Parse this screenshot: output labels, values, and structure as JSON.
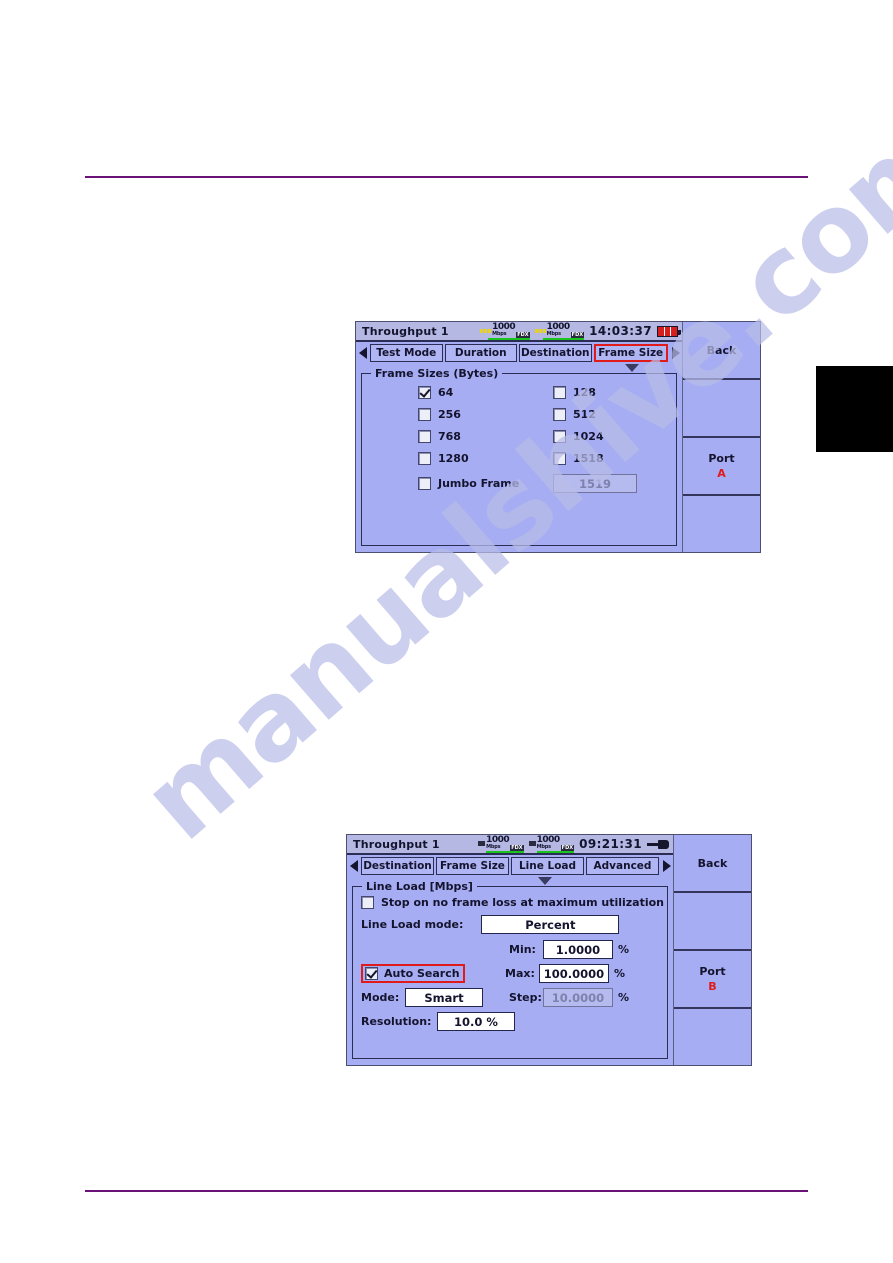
{
  "page": {
    "watermark_text": "manualshive.com",
    "rule_color": "#6b1278",
    "chapter_tab_color": "#000000"
  },
  "screenshot_frame_size": {
    "titlebar": {
      "title": "Throughput 1",
      "clock": "14:03:37",
      "port_indicators": [
        {
          "speed": "1000",
          "unit": "Mbps",
          "duplex": "FDX",
          "link": "up"
        },
        {
          "speed": "1000",
          "unit": "Mbps",
          "duplex": "FDX",
          "link": "up"
        }
      ],
      "power_icon": "battery-icon"
    },
    "tabs": {
      "prev_icon": "chevron-left-icon",
      "next_icon": "chevron-right-icon",
      "items": [
        {
          "label": "Test Mode",
          "selected": false
        },
        {
          "label": "Duration",
          "selected": false
        },
        {
          "label": "Destination",
          "selected": false
        },
        {
          "label": "Frame Size",
          "selected": true
        }
      ]
    },
    "group": {
      "title": "Frame Sizes (Bytes)",
      "checkboxes": [
        {
          "label": "64",
          "checked": true
        },
        {
          "label": "128",
          "checked": false
        },
        {
          "label": "256",
          "checked": false
        },
        {
          "label": "512",
          "checked": false
        },
        {
          "label": "768",
          "checked": false
        },
        {
          "label": "1024",
          "checked": false
        },
        {
          "label": "1280",
          "checked": false
        },
        {
          "label": "1518",
          "checked": false
        }
      ],
      "jumbo": {
        "label": "Jumbo Frame",
        "checked": false,
        "value": "1519",
        "disabled": true
      }
    },
    "side_buttons": [
      {
        "label": "Back",
        "sub": ""
      },
      {
        "label": "",
        "sub": ""
      },
      {
        "label": "Port",
        "sub": "A"
      },
      {
        "label": "",
        "sub": ""
      }
    ]
  },
  "screenshot_line_load": {
    "titlebar": {
      "title": "Throughput 1",
      "clock": "09:21:31",
      "port_indicators": [
        {
          "speed": "1000",
          "unit": "Mbps",
          "duplex": "FDX",
          "link": "up"
        },
        {
          "speed": "1000",
          "unit": "Mbps",
          "duplex": "FDX",
          "link": "up"
        }
      ],
      "power_icon": "power-plug-icon"
    },
    "tabs": {
      "prev_icon": "chevron-left-icon",
      "next_icon": "chevron-right-icon",
      "items": [
        {
          "label": "Destination",
          "selected": false
        },
        {
          "label": "Frame Size",
          "selected": false
        },
        {
          "label": "Line Load",
          "selected": true
        },
        {
          "label": "Advanced",
          "selected": false
        }
      ]
    },
    "group": {
      "title": "Line Load [Mbps]",
      "stop_checkbox": {
        "label": "Stop on no frame loss at maximum utilization",
        "checked": false
      },
      "mode_label": "Line Load mode:",
      "mode_value": "Percent",
      "auto_search": {
        "label": "Auto Search",
        "checked": true,
        "highlighted": true
      },
      "search_mode_label": "Mode:",
      "search_mode_value": "Smart",
      "resolution_label": "Resolution:",
      "resolution_value": "10.0 %",
      "fields": [
        {
          "label": "Min:",
          "value": "1.0000",
          "unit": "%",
          "disabled": false
        },
        {
          "label": "Max:",
          "value": "100.0000",
          "unit": "%",
          "disabled": false
        },
        {
          "label": "Step:",
          "value": "10.0000",
          "unit": "%",
          "disabled": true
        }
      ]
    },
    "side_buttons": [
      {
        "label": "Back",
        "sub": ""
      },
      {
        "label": "",
        "sub": ""
      },
      {
        "label": "Port",
        "sub": "B"
      },
      {
        "label": "",
        "sub": ""
      }
    ]
  }
}
